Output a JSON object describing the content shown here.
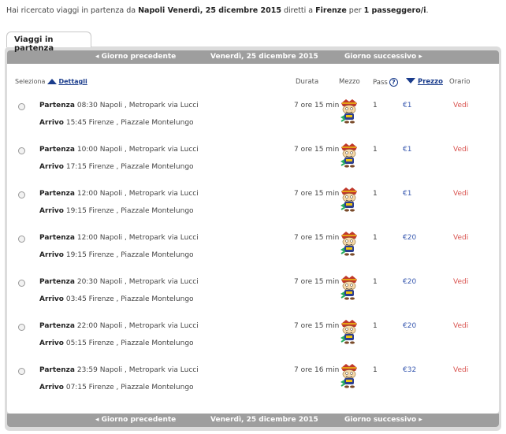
{
  "summary": {
    "prefix": "Hai ricercato viaggi in partenza da ",
    "origin_date": "Napoli Venerdì, 25 dicembre 2015",
    "middle": " diretti a ",
    "destination": "Firenze",
    "middle2": " per ",
    "passengers": "1 passeggero/i",
    "suffix": "."
  },
  "tab": {
    "label": "Viaggi in partenza"
  },
  "nav": {
    "prev_label": "◂  Giorno precedente",
    "date_label": "Venerdì, 25 dicembre 2015",
    "next_label": "Giorno successivo  ▸"
  },
  "headers": {
    "seleziona": "Seleziona",
    "dettagli": "Dettagli",
    "durata": "Durata",
    "mezzo": "Mezzo",
    "pass": "Pass",
    "prezzo": "Prezzo",
    "orario": "Orario"
  },
  "rows": [
    {
      "partenza_label": "Partenza",
      "dep_time": "08:30",
      "dep_place": "Napoli , Metropark via Lucci",
      "arrivo_label": "Arrivo",
      "arr_time": "15:45",
      "arr_place": "Firenze , Piazzale Montelungo",
      "durata": "7 ore 15 min",
      "pass": "1",
      "price": "€1",
      "orario": "Vedi"
    },
    {
      "partenza_label": "Partenza",
      "dep_time": "10:00",
      "dep_place": "Napoli , Metropark via Lucci",
      "arrivo_label": "Arrivo",
      "arr_time": "17:15",
      "arr_place": "Firenze , Piazzale Montelungo",
      "durata": "7 ore 15 min",
      "pass": "1",
      "price": "€1",
      "orario": "Vedi"
    },
    {
      "partenza_label": "Partenza",
      "dep_time": "12:00",
      "dep_place": "Napoli , Metropark via Lucci",
      "arrivo_label": "Arrivo",
      "arr_time": "19:15",
      "arr_place": "Firenze , Piazzale Montelungo",
      "durata": "7 ore 15 min",
      "pass": "1",
      "price": "€1",
      "orario": "Vedi"
    },
    {
      "partenza_label": "Partenza",
      "dep_time": "12:00",
      "dep_place": "Napoli , Metropark via Lucci",
      "arrivo_label": "Arrivo",
      "arr_time": "19:15",
      "arr_place": "Firenze , Piazzale Montelungo",
      "durata": "7 ore 15 min",
      "pass": "1",
      "price": "€20",
      "orario": "Vedi"
    },
    {
      "partenza_label": "Partenza",
      "dep_time": "20:30",
      "dep_place": "Napoli , Metropark via Lucci",
      "arrivo_label": "Arrivo",
      "arr_time": "03:45",
      "arr_place": "Firenze , Piazzale Montelungo",
      "durata": "7 ore 15 min",
      "pass": "1",
      "price": "€20",
      "orario": "Vedi"
    },
    {
      "partenza_label": "Partenza",
      "dep_time": "22:00",
      "dep_place": "Napoli , Metropark via Lucci",
      "arrivo_label": "Arrivo",
      "arr_time": "05:15",
      "arr_place": "Firenze , Piazzale Montelungo",
      "durata": "7 ore 15 min",
      "pass": "1",
      "price": "€20",
      "orario": "Vedi"
    },
    {
      "partenza_label": "Partenza",
      "dep_time": "23:59",
      "dep_place": "Napoli , Metropark via Lucci",
      "arrivo_label": "Arrivo",
      "arr_time": "07:15",
      "arr_place": "Firenze , Piazzale Montelungo",
      "durata": "7 ore 16 min",
      "pass": "1",
      "price": "€32",
      "orario": "Vedi"
    }
  ],
  "icons": {
    "bus": "bus-mascot-icon",
    "help": "question-icon",
    "sort_asc": "sort-up-icon",
    "sort_desc": "sort-down-icon"
  },
  "colors": {
    "navbar": "#9e9e9e",
    "link": "#1a3c8c",
    "price": "#3a5ab0",
    "vedi": "#d9534f"
  }
}
